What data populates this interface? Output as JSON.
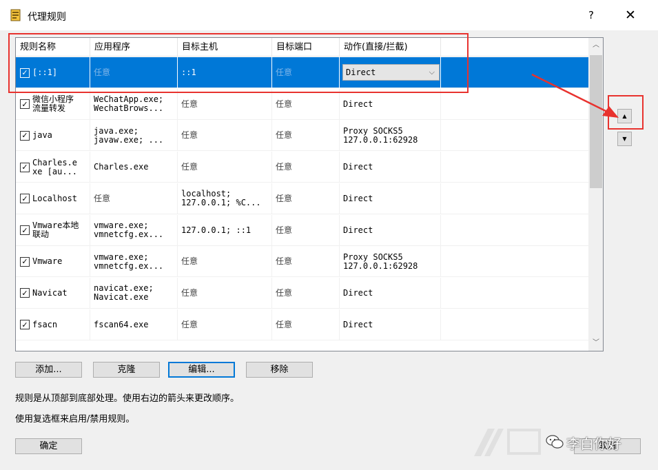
{
  "window": {
    "title": "代理规则",
    "help_label": "?",
    "close_label": "✕"
  },
  "columns": [
    "规则名称",
    "应用程序",
    "目标主机",
    "目标端口",
    "动作(直接/拦截)"
  ],
  "rows": [
    {
      "name": "[::1]",
      "app": "任意",
      "host": "::1",
      "port": "任意",
      "action": "Direct",
      "checked": true,
      "selected": true
    },
    {
      "name": "微信小程序\n流量转发",
      "app": "WeChatApp.exe;\nWechatBrows...",
      "host": "任意",
      "port": "任意",
      "action": "Direct",
      "checked": true,
      "selected": false
    },
    {
      "name": "java",
      "app": "java.exe;\njavaw.exe; ...",
      "host": "任意",
      "port": "任意",
      "action": "Proxy SOCKS5\n127.0.0.1:62928",
      "checked": true,
      "selected": false
    },
    {
      "name": "Charles.e\nxe [au...",
      "app": "Charles.exe",
      "host": "任意",
      "port": "任意",
      "action": "Direct",
      "checked": true,
      "selected": false
    },
    {
      "name": "Localhost",
      "app": "任意",
      "host": "localhost;\n127.0.0.1; %C...",
      "port": "任意",
      "action": "Direct",
      "checked": true,
      "selected": false
    },
    {
      "name": "Vmware本地\n联动",
      "app": "vmware.exe;\nvmnetcfg.ex...",
      "host": "127.0.0.1; ::1",
      "port": "任意",
      "action": "Direct",
      "checked": true,
      "selected": false
    },
    {
      "name": "Vmware",
      "app": "vmware.exe;\nvmnetcfg.ex...",
      "host": "任意",
      "port": "任意",
      "action": "Proxy SOCKS5\n127.0.0.1:62928",
      "checked": true,
      "selected": false
    },
    {
      "name": "Navicat",
      "app": "navicat.exe;\nNavicat.exe",
      "host": "任意",
      "port": "任意",
      "action": "Direct",
      "checked": true,
      "selected": false
    },
    {
      "name": "fsacn",
      "app": "fscan64.exe",
      "host": "任意",
      "port": "任意",
      "action": "Direct",
      "checked": true,
      "selected": false
    }
  ],
  "buttons": {
    "add": "添加...",
    "clone": "克隆",
    "edit": "编辑...",
    "remove": "移除",
    "ok": "确定",
    "cancel": "取消"
  },
  "move_up_label": "▲",
  "move_down_label": "▼",
  "scroll_up_label": "︿",
  "scroll_down_label": "﹀",
  "info": {
    "line1": "规则是从顶部到底部处理。使用右边的箭头来更改顺序。",
    "line2": "使用复选框来启用/禁用规则。"
  },
  "watermark": "李白你好",
  "colors": {
    "selection": "#0078d7",
    "annotation_red": "#e8322e"
  }
}
